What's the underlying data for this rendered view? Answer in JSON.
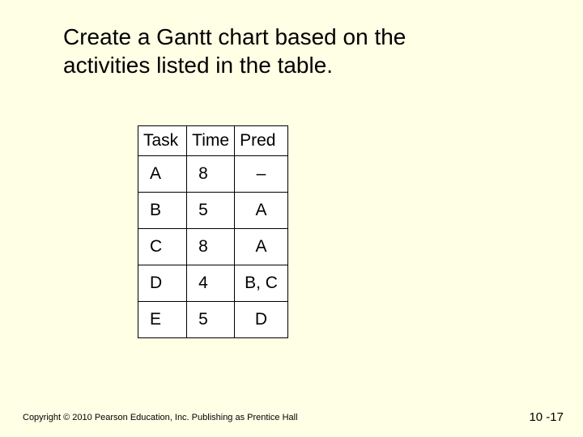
{
  "title": "Create a Gantt chart based on the activities listed in the table.",
  "table": {
    "headers": [
      "Task",
      "Time",
      "Pred"
    ],
    "rows": [
      {
        "task": "A",
        "time": "8",
        "pred": "–"
      },
      {
        "task": "B",
        "time": "5",
        "pred": "A"
      },
      {
        "task": "C",
        "time": "8",
        "pred": "A"
      },
      {
        "task": "D",
        "time": "4",
        "pred": "B, C"
      },
      {
        "task": "E",
        "time": "5",
        "pred": "D"
      }
    ]
  },
  "footer": {
    "copyright": "Copyright © 2010 Pearson Education, Inc. Publishing as Prentice Hall",
    "slide_number": "10 -17"
  },
  "chart_data": {
    "type": "table",
    "columns": [
      "Task",
      "Time",
      "Pred"
    ],
    "rows": [
      [
        "A",
        8,
        null
      ],
      [
        "B",
        5,
        "A"
      ],
      [
        "C",
        8,
        "A"
      ],
      [
        "D",
        4,
        "B, C"
      ],
      [
        "E",
        5,
        "D"
      ]
    ]
  }
}
